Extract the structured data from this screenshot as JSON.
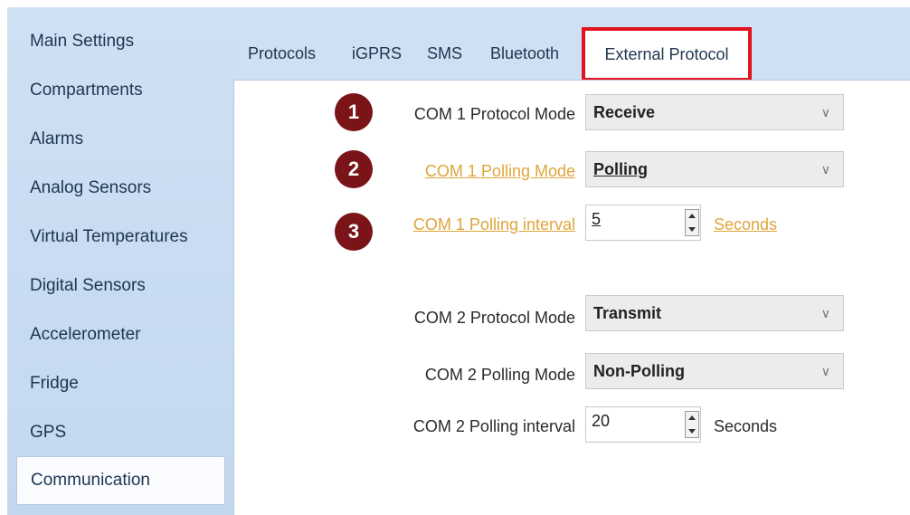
{
  "sidebar": {
    "items": [
      {
        "label": "Main Settings"
      },
      {
        "label": "Compartments"
      },
      {
        "label": "Alarms"
      },
      {
        "label": "Analog Sensors"
      },
      {
        "label": "Virtual Temperatures"
      },
      {
        "label": "Digital Sensors"
      },
      {
        "label": "Accelerometer"
      },
      {
        "label": "Fridge"
      },
      {
        "label": "GPS"
      },
      {
        "label": "Communication",
        "selected": true
      }
    ]
  },
  "tabs": [
    {
      "label": "Protocols"
    },
    {
      "label": "iGPRS"
    },
    {
      "label": "SMS"
    },
    {
      "label": "Bluetooth"
    },
    {
      "label": "External Protocol",
      "active": true
    }
  ],
  "annotations": [
    "1",
    "2",
    "3"
  ],
  "form": {
    "com1_protocol_mode": {
      "label": "COM 1 Protocol Mode",
      "value": "Receive"
    },
    "com1_polling_mode": {
      "label": "COM 1 Polling Mode",
      "value": "Polling"
    },
    "com1_polling_interval": {
      "label": "COM 1 Polling interval",
      "value": "5",
      "unit": "Seconds"
    },
    "com2_protocol_mode": {
      "label": "COM 2 Protocol Mode",
      "value": "Transmit"
    },
    "com2_polling_mode": {
      "label": "COM 2 Polling Mode",
      "value": "Non-Polling"
    },
    "com2_polling_interval": {
      "label": "COM 2 Polling interval",
      "value": "20",
      "unit": "Seconds"
    }
  },
  "colors": {
    "highlight_box": "#e2141f",
    "annotation_badge": "#7a1419",
    "link_label": "#e0a43a",
    "sidebar_bg": "#cfe0f3"
  }
}
